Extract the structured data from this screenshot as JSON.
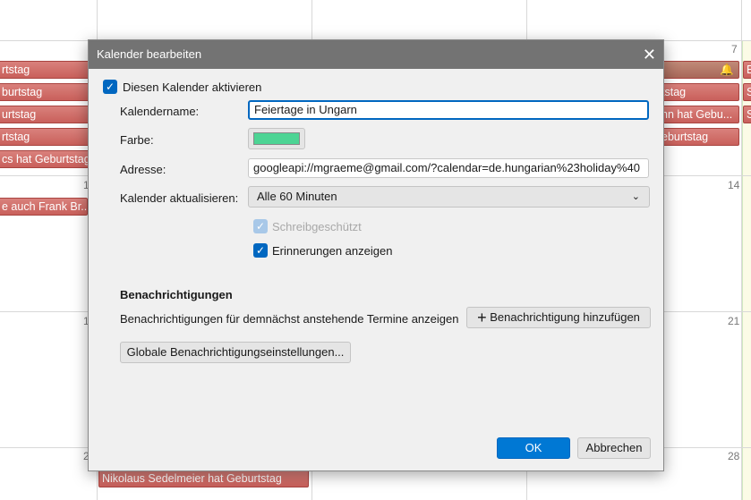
{
  "calendar": {
    "day_numbers": [
      "7",
      "14",
      "21",
      "28",
      "1",
      "1",
      "2"
    ],
    "events_left": [
      "rtstag",
      "burtstag",
      "urtstag",
      "rtstag",
      "cs hat Geburtstag",
      "e auch Frank Br..."
    ],
    "events_right": [
      "",
      "tstag",
      "nn hat Gebu...",
      "eburtstag"
    ],
    "events_far_right": [
      "E",
      "S",
      "S"
    ],
    "event_bottom": "Nikolaus Sedelmeier hat Geburtstag"
  },
  "dialog": {
    "title": "Kalender bearbeiten",
    "enable_label": "Diesen Kalender aktivieren",
    "name_label": "Kalendername:",
    "name_value": "Feiertage in Ungarn",
    "color_label": "Farbe:",
    "color_value": "#4cd494",
    "address_label": "Adresse:",
    "address_value": "googleapi://mgraeme@gmail.com/?calendar=de.hungarian%23holiday%40",
    "refresh_label": "Kalender aktualisieren:",
    "refresh_value": "Alle 60 Minuten",
    "readonly_label": "Schreibgeschützt",
    "reminders_label": "Erinnerungen anzeigen",
    "notifications_heading": "Benachrichtigungen",
    "notifications_text": "Benachrichtigungen für demnächst anstehende Termine anzeigen",
    "add_notification": "Benachrichtigung hinzufügen",
    "global_settings": "Globale Benachrichtigungseinstellungen...",
    "ok": "OK",
    "cancel": "Abbrechen"
  }
}
